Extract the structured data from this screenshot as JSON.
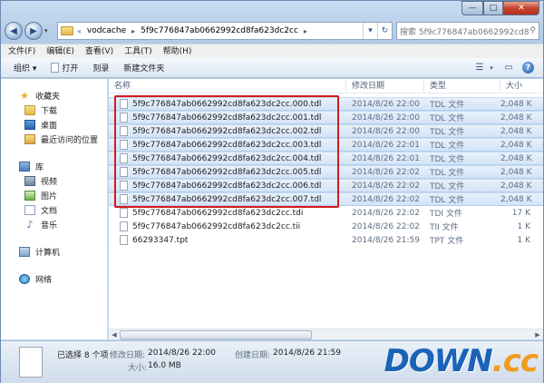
{
  "window": {
    "caption_min": "—",
    "caption_max": "□",
    "caption_close": "✕"
  },
  "address": {
    "crumbs": [
      "vodcache",
      "5f9c776847ab0662992cd8fa623dc2cc"
    ],
    "separator": "▸",
    "overflow": "«",
    "search_placeholder": "搜索 5f9c776847ab0662992cd8fa6..."
  },
  "menubar": [
    "文件(F)",
    "编辑(E)",
    "查看(V)",
    "工具(T)",
    "帮助(H)"
  ],
  "toolbar": {
    "organize": "组织 ▾",
    "open": "打开",
    "burn": "刻录",
    "new_folder": "新建文件夹"
  },
  "nav": {
    "favorites": "收藏夹",
    "favorites_items": [
      "下载",
      "桌面",
      "最近访问的位置"
    ],
    "libraries": "库",
    "libraries_items": [
      "视频",
      "图片",
      "文档",
      "音乐"
    ],
    "computer": "计算机",
    "network": "网络"
  },
  "columns": {
    "name": "名称",
    "date": "修改日期",
    "type": "类型",
    "size": "大小"
  },
  "files": [
    {
      "name": "5f9c776847ab0662992cd8fa623dc2cc.000.tdl",
      "date": "2014/8/26 22:00",
      "type": "TDL 文件",
      "size": "2,048 K",
      "selected": true
    },
    {
      "name": "5f9c776847ab0662992cd8fa623dc2cc.001.tdl",
      "date": "2014/8/26 22:00",
      "type": "TDL 文件",
      "size": "2,048 K",
      "selected": true
    },
    {
      "name": "5f9c776847ab0662992cd8fa623dc2cc.002.tdl",
      "date": "2014/8/26 22:00",
      "type": "TDL 文件",
      "size": "2,048 K",
      "selected": true
    },
    {
      "name": "5f9c776847ab0662992cd8fa623dc2cc.003.tdl",
      "date": "2014/8/26 22:01",
      "type": "TDL 文件",
      "size": "2,048 K",
      "selected": true
    },
    {
      "name": "5f9c776847ab0662992cd8fa623dc2cc.004.tdl",
      "date": "2014/8/26 22:01",
      "type": "TDL 文件",
      "size": "2,048 K",
      "selected": true
    },
    {
      "name": "5f9c776847ab0662992cd8fa623dc2cc.005.tdl",
      "date": "2014/8/26 22:02",
      "type": "TDL 文件",
      "size": "2,048 K",
      "selected": true
    },
    {
      "name": "5f9c776847ab0662992cd8fa623dc2cc.006.tdl",
      "date": "2014/8/26 22:02",
      "type": "TDL 文件",
      "size": "2,048 K",
      "selected": true
    },
    {
      "name": "5f9c776847ab0662992cd8fa623dc2cc.007.tdl",
      "date": "2014/8/26 22:02",
      "type": "TDL 文件",
      "size": "2,048 K",
      "selected": true
    },
    {
      "name": "5f9c776847ab0662992cd8fa623dc2cc.tdi",
      "date": "2014/8/26 22:02",
      "type": "TDI 文件",
      "size": "17 K",
      "selected": false
    },
    {
      "name": "5f9c776847ab0662992cd8fa623dc2cc.tii",
      "date": "2014/8/26 22:02",
      "type": "TII 文件",
      "size": "1 K",
      "selected": false
    },
    {
      "name": "66293347.tpt",
      "date": "2014/8/26 21:59",
      "type": "TPT 文件",
      "size": "1 K",
      "selected": false
    }
  ],
  "details": {
    "selected": "已选择 8 个项",
    "modified_label": "修改日期:",
    "modified_value": "2014/8/26 22:00",
    "size_label": "大小:",
    "size_value": "16.0 MB",
    "created_label": "创建日期:",
    "created_value": "2014/8/26 21:59"
  },
  "watermark": {
    "main": "DOWN",
    "dot": ".",
    "tld": "cc"
  },
  "colors": {
    "highlight_box": "#d41a1a",
    "selection": "#d3e4f7",
    "logo_blue": "#1a63b8",
    "logo_orange": "#f19b1d"
  }
}
